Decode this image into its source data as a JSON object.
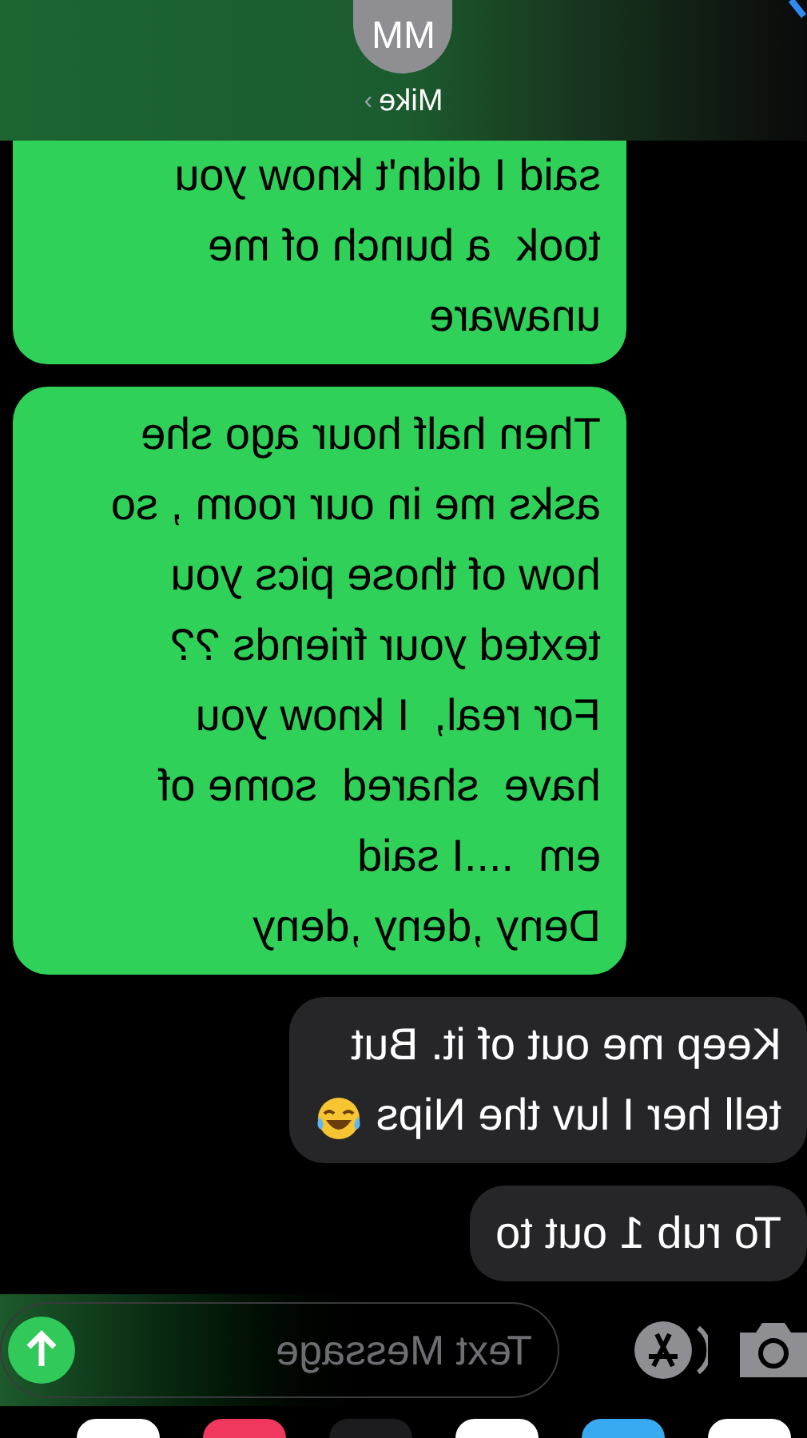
{
  "header": {
    "avatar_initials": "MM",
    "contact_name": "Mike",
    "chevron": "›"
  },
  "messages": [
    {
      "kind": "sent",
      "text": "said I didn't know you\ntook  a bunch of me\nunaware",
      "cut_top": true
    },
    {
      "kind": "sent",
      "text": "Then half hour ago she\nasks me in our room , so\nhow of those pics you\ntexted your friends ??\nFor real,  I know you\nhave  shared  some of\nem  ....I said\nDeny ,deny ,deny",
      "cut_top": false
    },
    {
      "kind": "received",
      "text": "Keep me out of it. But\ntell her I luv the Nips",
      "emoji": true,
      "cut_top": false
    },
    {
      "kind": "received",
      "text": "To rub 1 out to",
      "emoji": false,
      "cut_top": false
    }
  ],
  "composer": {
    "placeholder": "Text Message"
  }
}
